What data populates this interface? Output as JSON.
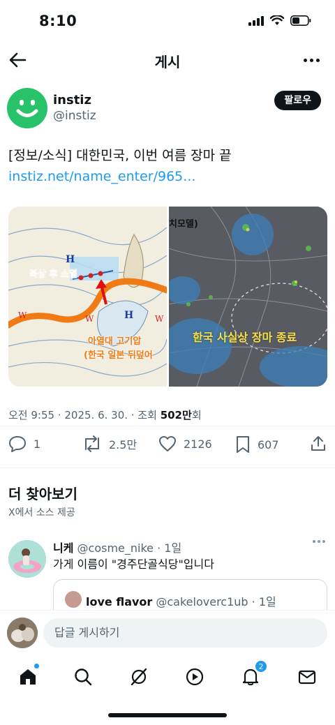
{
  "status_bar": {
    "time": "8:10"
  },
  "nav": {
    "title": "게시"
  },
  "author": {
    "name": "instiz",
    "handle": "@instiz",
    "follow_label": "팔로우"
  },
  "post": {
    "text": "[정보/소식] 대한민국, 이번 여름 장마 끝 ",
    "link_text": "instiz.net/name_enter/965...",
    "media": {
      "left_labels": [
        "북상 후 소멸",
        "아열대 고기압",
        "(한국 일본 뒤덮어"
      ],
      "right_labels": [
        "치모델)",
        "한국 사실상 장마 종료"
      ]
    }
  },
  "meta": {
    "time_date": "오전 9:55 · 2025. 6. 30. · 조회 ",
    "views": "502만",
    "views_suffix": "회"
  },
  "actions": {
    "replies": "1",
    "reposts": "2.5만",
    "likes": "2126",
    "bookmarks": "607"
  },
  "discover": {
    "title": "더 찾아보기",
    "subtitle": "X에서 소스 제공"
  },
  "reply": {
    "name": "니케",
    "handle_time": " @cosme_nike · 1일",
    "text": "가게 이름이 \"경주단골식당\"입니다",
    "quote_name": "love flavor",
    "quote_handle_time": " @cakeloverc1ub · 1일"
  },
  "compose": {
    "placeholder": "답글 게시하기"
  },
  "tab_bar": {
    "notification_count": "2"
  },
  "colors": {
    "accent": "#1d9bf0",
    "avatar_green": "#27c26a",
    "text": "#0f1419",
    "muted": "#536471"
  }
}
